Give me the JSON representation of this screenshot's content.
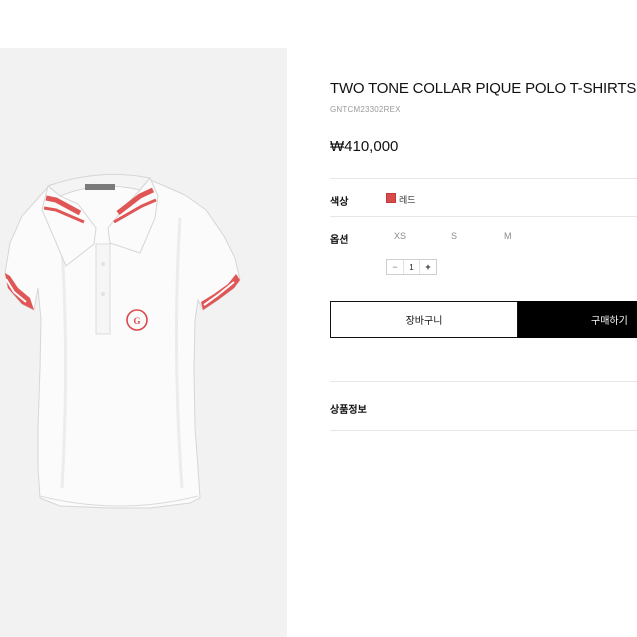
{
  "product": {
    "title": "TWO TONE COLLAR PIQUE POLO T-SHIRTS",
    "sku": "GNTCM23302REX",
    "price": "₩410,000",
    "image_logo_text": "G/FORE"
  },
  "options": {
    "color_label": "색상",
    "color_value": "레드",
    "color_hex": "#d94a4a",
    "size_label": "옵션",
    "sizes": [
      "XS",
      "S",
      "M"
    ],
    "quantity": "1",
    "minus": "−",
    "plus": "+"
  },
  "actions": {
    "cart_label": "장바구니",
    "buy_label": "구매하기"
  },
  "sections": {
    "detail_label": "상품정보"
  },
  "colors": {
    "accent": "#d94a4a",
    "button_dark": "#000000"
  }
}
